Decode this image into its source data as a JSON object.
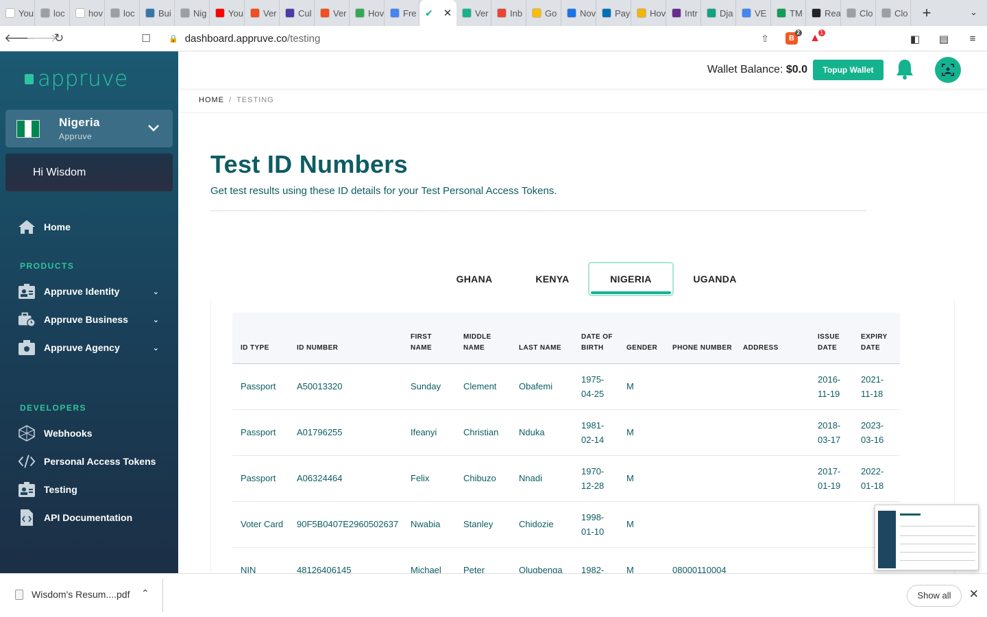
{
  "browser": {
    "tabs": [
      {
        "label": "You",
        "color": "#ffffff",
        "icon": "google-icon"
      },
      {
        "label": "loc",
        "color": "#9aa0a6",
        "icon": "globe-icon"
      },
      {
        "label": "hov",
        "color": "#ffffff",
        "icon": "google-icon"
      },
      {
        "label": "loc",
        "color": "#9aa0a6",
        "icon": "globe-icon"
      },
      {
        "label": "Bui",
        "color": "#3776ab",
        "icon": "python-icon"
      },
      {
        "label": "Nig",
        "color": "#9aa0a6",
        "icon": "globe-icon"
      },
      {
        "label": "You",
        "color": "#ff0000",
        "icon": "youtube-icon"
      },
      {
        "label": "Ver",
        "color": "#f24e1e",
        "icon": "figma-icon"
      },
      {
        "label": "Cul",
        "color": "#4b3aa8",
        "icon": "app-icon"
      },
      {
        "label": "Ver",
        "color": "#f24e1e",
        "icon": "figma-icon"
      },
      {
        "label": "Hov",
        "color": "#34a853",
        "icon": "app-icon"
      },
      {
        "label": "Fre",
        "color": "#4285f4",
        "icon": "docs-icon"
      }
    ],
    "active_tab_icon": "appruve-check-icon",
    "tabs_after": [
      {
        "label": "Ver",
        "color": "#14b38e",
        "icon": "app-icon"
      },
      {
        "label": "Inb",
        "color": "#ea4335",
        "icon": "gmail-icon"
      },
      {
        "label": "Go",
        "color": "#fbbc04",
        "icon": "app-icon"
      },
      {
        "label": "Nov",
        "color": "#1a73e8",
        "icon": "app-icon"
      },
      {
        "label": "Pay",
        "color": "#0070ba",
        "icon": "paypal-icon"
      },
      {
        "label": "Hov",
        "color": "#f4b400",
        "icon": "app-icon"
      },
      {
        "label": "Intr",
        "color": "#6b2c91",
        "icon": "app-icon"
      },
      {
        "label": "Dja",
        "color": "#10a37f",
        "icon": "openai-icon"
      },
      {
        "label": "VE",
        "color": "#4285f4",
        "icon": "docs-icon"
      },
      {
        "label": "TM",
        "color": "#0f9d58",
        "icon": "sheets-icon"
      },
      {
        "label": "Rea",
        "color": "#20232a",
        "icon": "react-icon"
      },
      {
        "label": "Clo",
        "color": "#9aa0a6",
        "icon": "globe-icon"
      },
      {
        "label": "Clo",
        "color": "#9aa0a6",
        "icon": "globe-icon"
      }
    ],
    "url_host": "dashboard.appruve.co",
    "url_path": "/testing",
    "brave_badge": "2",
    "ext_badge": "1"
  },
  "sidebar": {
    "logo": "appruve",
    "country": {
      "name": "Nigeria",
      "org": "Appruve"
    },
    "greeting": "Hi Wisdom",
    "home": "Home",
    "products_heading": "PRODUCTS",
    "products": [
      {
        "label": "Appruve Identity",
        "icon": "id-card-icon"
      },
      {
        "label": "Appruve Business",
        "icon": "briefcase-clock-icon"
      },
      {
        "label": "Appruve Agency",
        "icon": "agency-icon"
      }
    ],
    "developers_heading": "DEVELOPERS",
    "developers": [
      {
        "label": "Webhooks",
        "icon": "webhooks-icon"
      },
      {
        "label": "Personal Access Tokens",
        "icon": "code-icon"
      },
      {
        "label": "Testing",
        "icon": "id-card-icon"
      },
      {
        "label": "API Documentation",
        "icon": "document-code-icon"
      }
    ]
  },
  "header": {
    "wallet_label": "Wallet Balance:",
    "wallet_value": "$0.0",
    "topup_label": "Topup Wallet",
    "accent": "#14b38e"
  },
  "breadcrumb": {
    "home": "HOME",
    "sep": "/",
    "current": "TESTING"
  },
  "page": {
    "title": "Test ID Numbers",
    "subtitle": "Get test results using these ID details for your Test Personal Access Tokens.",
    "title_color": "#0d5c63"
  },
  "country_tabs": [
    "GHANA",
    "KENYA",
    "NIGERIA",
    "UGANDA"
  ],
  "active_country": "NIGERIA",
  "table": {
    "headers": [
      "ID TYPE",
      "ID NUMBER",
      "FIRST NAME",
      "MIDDLE NAME",
      "LAST NAME",
      "DATE OF BIRTH",
      "GENDER",
      "PHONE NUMBER",
      "ADDRESS",
      "ISSUE DATE",
      "EXPIRY DATE"
    ],
    "rows": [
      [
        "Passport",
        "A50013320",
        "Sunday",
        "Clement",
        "Obafemi",
        "1975-04-25",
        "M",
        "",
        "",
        "2016-11-19",
        "2021-11-18"
      ],
      [
        "Passport",
        "A01796255",
        "Ifeanyi",
        "Christian",
        "Nduka",
        "1981-02-14",
        "M",
        "",
        "",
        "2018-03-17",
        "2023-03-16"
      ],
      [
        "Passport",
        "A06324464",
        "Felix",
        "Chibuzo",
        "Nnadi",
        "1970-12-28",
        "M",
        "",
        "",
        "2017-01-19",
        "2022-01-18"
      ],
      [
        "Voter Card",
        "90F5B0407E2960502637",
        "Nwabia",
        "Stanley",
        "Chidozie",
        "1998-01-10",
        "M",
        "",
        "",
        "",
        ""
      ],
      [
        "NIN",
        "48126406145",
        "Michael",
        "Peter",
        "Olugbenga",
        "1982-",
        "M",
        "08000110004",
        "",
        "",
        ""
      ]
    ]
  },
  "downloads": {
    "file": "Wisdom's Resum....pdf",
    "show_all": "Show all"
  }
}
